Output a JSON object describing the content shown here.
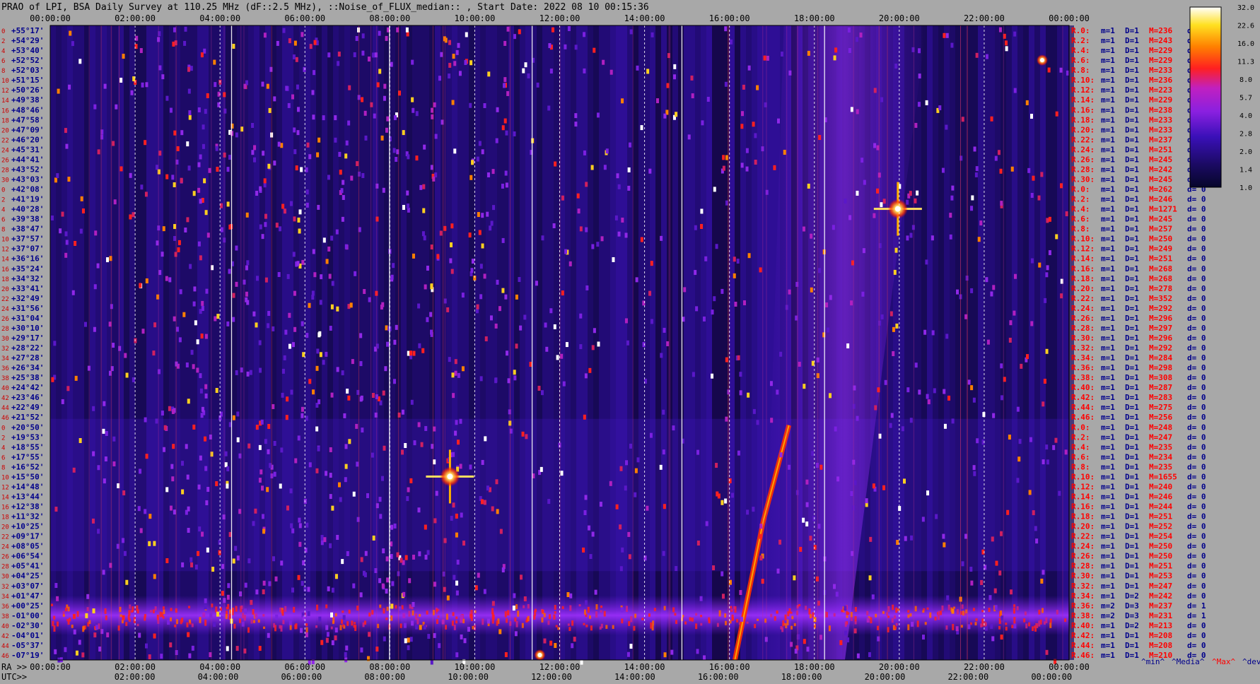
{
  "title": "PRAO of LPI, BSA Daily Survey at 110.25 MHz (dF::2.5 MHz), ::Noise_of_FLUX_median:: , Start Date: 2022 08 10 00:15:36",
  "chart_data": {
    "type": "heatmap",
    "title": "PRAO of LPI, BSA Daily Survey at 110.25 MHz (dF::2.5 MHz), ::Noise_of_FLUX_median:: , Start Date: 2022 08 10 00:15:36",
    "x_top_ticks": [
      "00:00:00",
      "02:00:00",
      "04:00:00",
      "06:00:00",
      "08:00:00",
      "10:00:00",
      "12:00:00",
      "14:00:00",
      "16:00:00",
      "18:00:00",
      "20:00:00",
      "22:00:00",
      "00:00:00"
    ],
    "x_bottom_ra_label": "RA >>",
    "x_bottom_ra_ticks": [
      "00:00:00",
      "02:00:00",
      "04:00:00",
      "06:00:00",
      "08:00:00",
      "10:00:00",
      "12:00:00",
      "14:00:00",
      "16:00:00",
      "18:00:00",
      "20:00:00",
      "22:00:00",
      "00:00:00"
    ],
    "x_bottom_utc_label": "UTC>>",
    "x_bottom_utc_ticks": [
      "02:00:00",
      "04:00:00",
      "06:00:00",
      "08:00:00",
      "10:00:00",
      "12:00:00",
      "14:00:00",
      "16:00:00",
      "18:00:00",
      "20:00:00",
      "22:00:00",
      "00:00:00"
    ],
    "y_index": [
      "0",
      "2",
      "4",
      "6",
      "8",
      "10",
      "12",
      "14",
      "16",
      "18",
      "20",
      "22",
      "24",
      "26",
      "28",
      "30",
      "0",
      "2",
      "4",
      "6",
      "8",
      "10",
      "12",
      "14",
      "16",
      "18",
      "20",
      "22",
      "24",
      "26",
      "28",
      "30",
      "32",
      "34",
      "36",
      "38",
      "40",
      "42",
      "44",
      "46",
      "0",
      "2",
      "4",
      "6",
      "8",
      "10",
      "12",
      "14",
      "16",
      "18",
      "20",
      "22",
      "24",
      "26",
      "28",
      "30",
      "32",
      "34",
      "36",
      "38",
      "40",
      "42",
      "44",
      "46"
    ],
    "y_dec_ticks": [
      "+55°17'",
      "+54°29'",
      "+53°40'",
      "+52°52'",
      "+52°03'",
      "+51°15'",
      "+50°26'",
      "+49°38'",
      "+48°46'",
      "+47°58'",
      "+47°09'",
      "+46°20'",
      "+45°31'",
      "+44°41'",
      "+43°52'",
      "+43°03'",
      "+42°08'",
      "+41°19'",
      "+40°28'",
      "+39°38'",
      "+38°47'",
      "+37°57'",
      "+37°07'",
      "+36°16'",
      "+35°24'",
      "+34°32'",
      "+33°41'",
      "+32°49'",
      "+31°56'",
      "+31°04'",
      "+30°10'",
      "+29°17'",
      "+28°22'",
      "+27°28'",
      "+26°34'",
      "+25°38'",
      "+24°42'",
      "+23°46'",
      "+22°49'",
      "+21°52'",
      "+20°50'",
      "+19°53'",
      "+18°55'",
      "+17°55'",
      "+16°52'",
      "+15°50'",
      "+14°48'",
      "+13°44'",
      "+12°38'",
      "+11°32'",
      "+10°25'",
      "+09°17'",
      "+08°05'",
      "+06°54'",
      "+05°41'",
      "+04°25'",
      "+03°07'",
      "+01°47'",
      "+00°25'",
      "-01°00'",
      "-02°30'",
      "-04°01'",
      "-05°37'",
      "-07°19'"
    ],
    "colorbar": {
      "ticks": [
        "32.0",
        "22.6",
        "16.0",
        "11.3",
        "8.0",
        "5.7",
        "4.0",
        "2.8",
        "2.0",
        "1.4",
        "1.0"
      ],
      "scale": "log",
      "range": [
        1.0,
        32.0
      ]
    },
    "row_stats": [
      {
        "r": "R.0:",
        "m": "m=1",
        "d": "D=1",
        "M": "M=236",
        "dev": "d= 0"
      },
      {
        "r": "R.2:",
        "m": "m=1",
        "d": "D=1",
        "M": "M=243",
        "dev": "d= 0"
      },
      {
        "r": "R.4:",
        "m": "m=1",
        "d": "D=1",
        "M": "M=229",
        "dev": "d= 0"
      },
      {
        "r": "R.6:",
        "m": "m=1",
        "d": "D=1",
        "M": "M=229",
        "dev": "d= 0"
      },
      {
        "r": "R.8:",
        "m": "m=1",
        "d": "D=1",
        "M": "M=233",
        "dev": "d= 0"
      },
      {
        "r": "R.10:",
        "m": "m=1",
        "d": "D=1",
        "M": "M=236",
        "dev": "d="
      },
      {
        "r": "R.12:",
        "m": "m=1",
        "d": "D=1",
        "M": "M=223",
        "dev": "d="
      },
      {
        "r": "R.14:",
        "m": "m=1",
        "d": "D=1",
        "M": "M=229",
        "dev": "d="
      },
      {
        "r": "R.16:",
        "m": "m=1",
        "d": "D=1",
        "M": "M=238",
        "dev": "d="
      },
      {
        "r": "R.18:",
        "m": "m=1",
        "d": "D=1",
        "M": "M=233",
        "dev": "d="
      },
      {
        "r": "R.20:",
        "m": "m=1",
        "d": "D=1",
        "M": "M=233",
        "dev": "d="
      },
      {
        "r": "R.22:",
        "m": "m=1",
        "d": "D=1",
        "M": "M=237",
        "dev": "d="
      },
      {
        "r": "R.24:",
        "m": "m=1",
        "d": "D=1",
        "M": "M=251",
        "dev": "d="
      },
      {
        "r": "R.26:",
        "m": "m=1",
        "d": "D=1",
        "M": "M=245",
        "dev": "d="
      },
      {
        "r": "R.28:",
        "m": "m=1",
        "d": "D=1",
        "M": "M=242",
        "dev": "d="
      },
      {
        "r": "R.30:",
        "m": "m=1",
        "d": "D=1",
        "M": "M=245",
        "dev": "d="
      },
      {
        "r": "R.0:",
        "m": "m=1",
        "d": "D=1",
        "M": "M=262",
        "dev": "d= 0"
      },
      {
        "r": "R.2:",
        "m": "m=1",
        "d": "D=1",
        "M": "M=246",
        "dev": "d= 0"
      },
      {
        "r": "R.4:",
        "m": "m=1",
        "d": "D=1",
        "M": "M=1271",
        "dev": "d= 0"
      },
      {
        "r": "R.6:",
        "m": "m=1",
        "d": "D=1",
        "M": "M=245",
        "dev": "d= 0"
      },
      {
        "r": "R.8:",
        "m": "m=1",
        "d": "D=1",
        "M": "M=257",
        "dev": "d= 0"
      },
      {
        "r": "R.10:",
        "m": "m=1",
        "d": "D=1",
        "M": "M=250",
        "dev": "d= 0"
      },
      {
        "r": "R.12:",
        "m": "m=1",
        "d": "D=1",
        "M": "M=249",
        "dev": "d= 0"
      },
      {
        "r": "R.14:",
        "m": "m=1",
        "d": "D=1",
        "M": "M=251",
        "dev": "d= 0"
      },
      {
        "r": "R.16:",
        "m": "m=1",
        "d": "D=1",
        "M": "M=268",
        "dev": "d= 0"
      },
      {
        "r": "R.18:",
        "m": "m=1",
        "d": "D=1",
        "M": "M=268",
        "dev": "d= 0"
      },
      {
        "r": "R.20:",
        "m": "m=1",
        "d": "D=1",
        "M": "M=278",
        "dev": "d= 0"
      },
      {
        "r": "R.22:",
        "m": "m=1",
        "d": "D=1",
        "M": "M=352",
        "dev": "d= 0"
      },
      {
        "r": "R.24:",
        "m": "m=1",
        "d": "D=1",
        "M": "M=292",
        "dev": "d= 0"
      },
      {
        "r": "R.26:",
        "m": "m=1",
        "d": "D=1",
        "M": "M=296",
        "dev": "d= 0"
      },
      {
        "r": "R.28:",
        "m": "m=1",
        "d": "D=1",
        "M": "M=297",
        "dev": "d= 0"
      },
      {
        "r": "R.30:",
        "m": "m=1",
        "d": "D=1",
        "M": "M=296",
        "dev": "d= 0"
      },
      {
        "r": "R.32:",
        "m": "m=1",
        "d": "D=1",
        "M": "M=292",
        "dev": "d= 0"
      },
      {
        "r": "R.34:",
        "m": "m=1",
        "d": "D=1",
        "M": "M=284",
        "dev": "d= 0"
      },
      {
        "r": "R.36:",
        "m": "m=1",
        "d": "D=1",
        "M": "M=298",
        "dev": "d= 0"
      },
      {
        "r": "R.38:",
        "m": "m=1",
        "d": "D=1",
        "M": "M=308",
        "dev": "d= 0"
      },
      {
        "r": "R.40:",
        "m": "m=1",
        "d": "D=1",
        "M": "M=287",
        "dev": "d= 0"
      },
      {
        "r": "R.42:",
        "m": "m=1",
        "d": "D=1",
        "M": "M=283",
        "dev": "d= 0"
      },
      {
        "r": "R.44:",
        "m": "m=1",
        "d": "D=1",
        "M": "M=275",
        "dev": "d= 0"
      },
      {
        "r": "R.46:",
        "m": "m=1",
        "d": "D=1",
        "M": "M=256",
        "dev": "d= 0"
      },
      {
        "r": "R.0:",
        "m": "m=1",
        "d": "D=1",
        "M": "M=248",
        "dev": "d= 0"
      },
      {
        "r": "R.2:",
        "m": "m=1",
        "d": "D=1",
        "M": "M=247",
        "dev": "d= 0"
      },
      {
        "r": "R.4:",
        "m": "m=1",
        "d": "D=1",
        "M": "M=235",
        "dev": "d= 0"
      },
      {
        "r": "R.6:",
        "m": "m=1",
        "d": "D=1",
        "M": "M=234",
        "dev": "d= 0"
      },
      {
        "r": "R.8:",
        "m": "m=1",
        "d": "D=1",
        "M": "M=235",
        "dev": "d= 0"
      },
      {
        "r": "R.10:",
        "m": "m=1",
        "d": "D=1",
        "M": "M=1655",
        "dev": "d= 0"
      },
      {
        "r": "R.12:",
        "m": "m=1",
        "d": "D=1",
        "M": "M=240",
        "dev": "d= 0"
      },
      {
        "r": "R.14:",
        "m": "m=1",
        "d": "D=1",
        "M": "M=246",
        "dev": "d= 0"
      },
      {
        "r": "R.16:",
        "m": "m=1",
        "d": "D=1",
        "M": "M=244",
        "dev": "d= 0"
      },
      {
        "r": "R.18:",
        "m": "m=1",
        "d": "D=1",
        "M": "M=251",
        "dev": "d= 0"
      },
      {
        "r": "R.20:",
        "m": "m=1",
        "d": "D=1",
        "M": "M=252",
        "dev": "d= 0"
      },
      {
        "r": "R.22:",
        "m": "m=1",
        "d": "D=1",
        "M": "M=254",
        "dev": "d= 0"
      },
      {
        "r": "R.24:",
        "m": "m=1",
        "d": "D=1",
        "M": "M=250",
        "dev": "d= 0"
      },
      {
        "r": "R.26:",
        "m": "m=1",
        "d": "D=1",
        "M": "M=250",
        "dev": "d= 0"
      },
      {
        "r": "R.28:",
        "m": "m=1",
        "d": "D=1",
        "M": "M=251",
        "dev": "d= 0"
      },
      {
        "r": "R.30:",
        "m": "m=1",
        "d": "D=1",
        "M": "M=253",
        "dev": "d= 0"
      },
      {
        "r": "R.32:",
        "m": "m=1",
        "d": "D=1",
        "M": "M=247",
        "dev": "d= 0"
      },
      {
        "r": "R.34:",
        "m": "m=1",
        "d": "D=2",
        "M": "M=242",
        "dev": "d= 0"
      },
      {
        "r": "R.36:",
        "m": "m=2",
        "d": "D=3",
        "M": "M=237",
        "dev": "d= 1"
      },
      {
        "r": "R.38:",
        "m": "m=2",
        "d": "D=3",
        "M": "M=231",
        "dev": "d= 1"
      },
      {
        "r": "R.40:",
        "m": "m=1",
        "d": "D=2",
        "M": "M=213",
        "dev": "d= 0"
      },
      {
        "r": "R.42:",
        "m": "m=1",
        "d": "D=1",
        "M": "M=208",
        "dev": "d= 0"
      },
      {
        "r": "R.44:",
        "m": "m=1",
        "d": "D=1",
        "M": "M=208",
        "dev": "d= 0"
      },
      {
        "r": "R.46:",
        "m": "m=1",
        "d": "D=1",
        "M": "M=210",
        "dev": "d= 0"
      }
    ],
    "legend_footer": [
      {
        "text": "^min^",
        "color": "#00008b"
      },
      {
        "text": "^Media^",
        "color": "#00008b"
      },
      {
        "text": "^Max^",
        "color": "#ff0000"
      },
      {
        "text": "^devia^",
        "color": "#00008b"
      }
    ],
    "bright_sources": [
      {
        "ra": "09:25",
        "dec": "+15°50'",
        "kind": "cross"
      },
      {
        "ra": "19:58",
        "dec": "+40°28'",
        "kind": "cross"
      },
      {
        "ra": "11:32",
        "dec": "-07°19'",
        "kind": "point"
      },
      {
        "ra": "23:22",
        "dec": "+52°52'",
        "kind": "point"
      }
    ],
    "colors": {
      "background": "#a8a8a8",
      "row_label_red": "#ff0000",
      "row_label_blue": "#00008b",
      "dec_label": "#0000aa",
      "grid": "#ffffff"
    }
  }
}
